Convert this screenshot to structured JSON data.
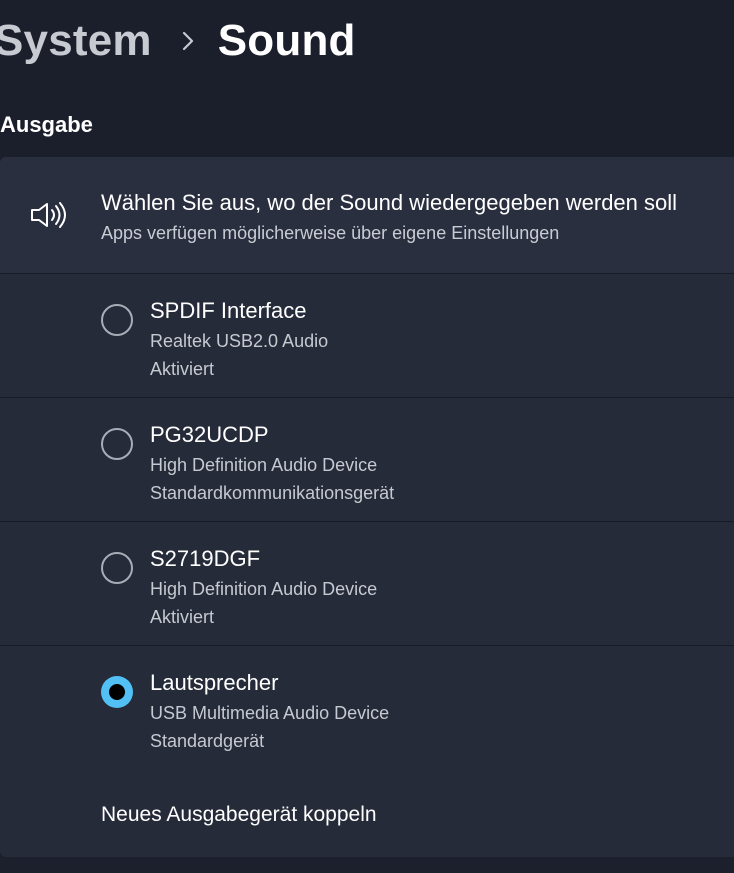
{
  "breadcrumb": {
    "parent": "System",
    "current": "Sound"
  },
  "section": {
    "title": "Ausgabe"
  },
  "output_header": {
    "icon": "speaker-icon",
    "title": "Wählen Sie aus, wo der Sound wiedergegeben werden soll",
    "subtitle": "Apps verfügen möglicherweise über eigene Einstellungen"
  },
  "devices": [
    {
      "name": "SPDIF Interface",
      "description": "Realtek USB2.0 Audio",
      "status": "Aktiviert",
      "selected": false
    },
    {
      "name": "PG32UCDP",
      "description": "High Definition Audio Device",
      "status": "Standardkommunikationsgerät",
      "selected": false
    },
    {
      "name": "S2719DGF",
      "description": "High Definition Audio Device",
      "status": "Aktiviert",
      "selected": false
    },
    {
      "name": "Lautsprecher",
      "description": "USB Multimedia Audio Device",
      "status": "Standardgerät",
      "selected": true
    }
  ],
  "pair": {
    "label": "Neues Ausgabegerät koppeln"
  },
  "colors": {
    "background": "#1b1f2c",
    "card": "#262b3a",
    "accent": "#52c0f5"
  }
}
